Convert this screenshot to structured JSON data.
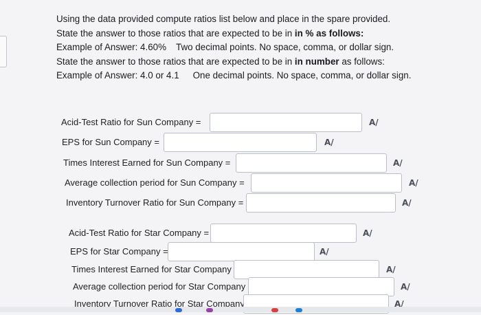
{
  "instructions": {
    "line1": "Using the data provided compute ratios list below and place in the spare provided.",
    "line2a": "State the answer to those ratios that are expected to be in ",
    "line2b": "% as follows:",
    "line3a": "Example of Answer: 4.60%",
    "line3b": "Two decimal points. No space, comma, or dollar sign.",
    "line4a": "State the answer to those ratios that are expected to be in ",
    "line4b": "number",
    "line4c": " as follows:",
    "line5a": "Example of Answer: 4.0 or 4.1",
    "line5b": "One decimal points. No space, comma, or dollar sign."
  },
  "sun": [
    {
      "label": "Acid-Test Ratio for Sun Company =",
      "value": ""
    },
    {
      "label": "EPS for Sun Company =",
      "value": ""
    },
    {
      "label": "Times Interest Earned for Sun Company =",
      "value": ""
    },
    {
      "label": "Average collection period  for Sun Company =",
      "value": ""
    },
    {
      "label": "Inventory Turnover Ratio for Sun Company =",
      "value": ""
    }
  ],
  "star": [
    {
      "label": "Acid-Test Ratio for Star Company =",
      "value": ""
    },
    {
      "label": "EPS for Star Company =",
      "value": ""
    },
    {
      "label": "Times Interest Earned for Star Company =",
      "value": ""
    },
    {
      "label": "Average collection period for Star Company =",
      "value": ""
    },
    {
      "label": "Inventory Turnover Ratio for Star Company =",
      "value": ""
    }
  ],
  "spell_icon": "spell-check-icon",
  "spell_glyph": "A/"
}
